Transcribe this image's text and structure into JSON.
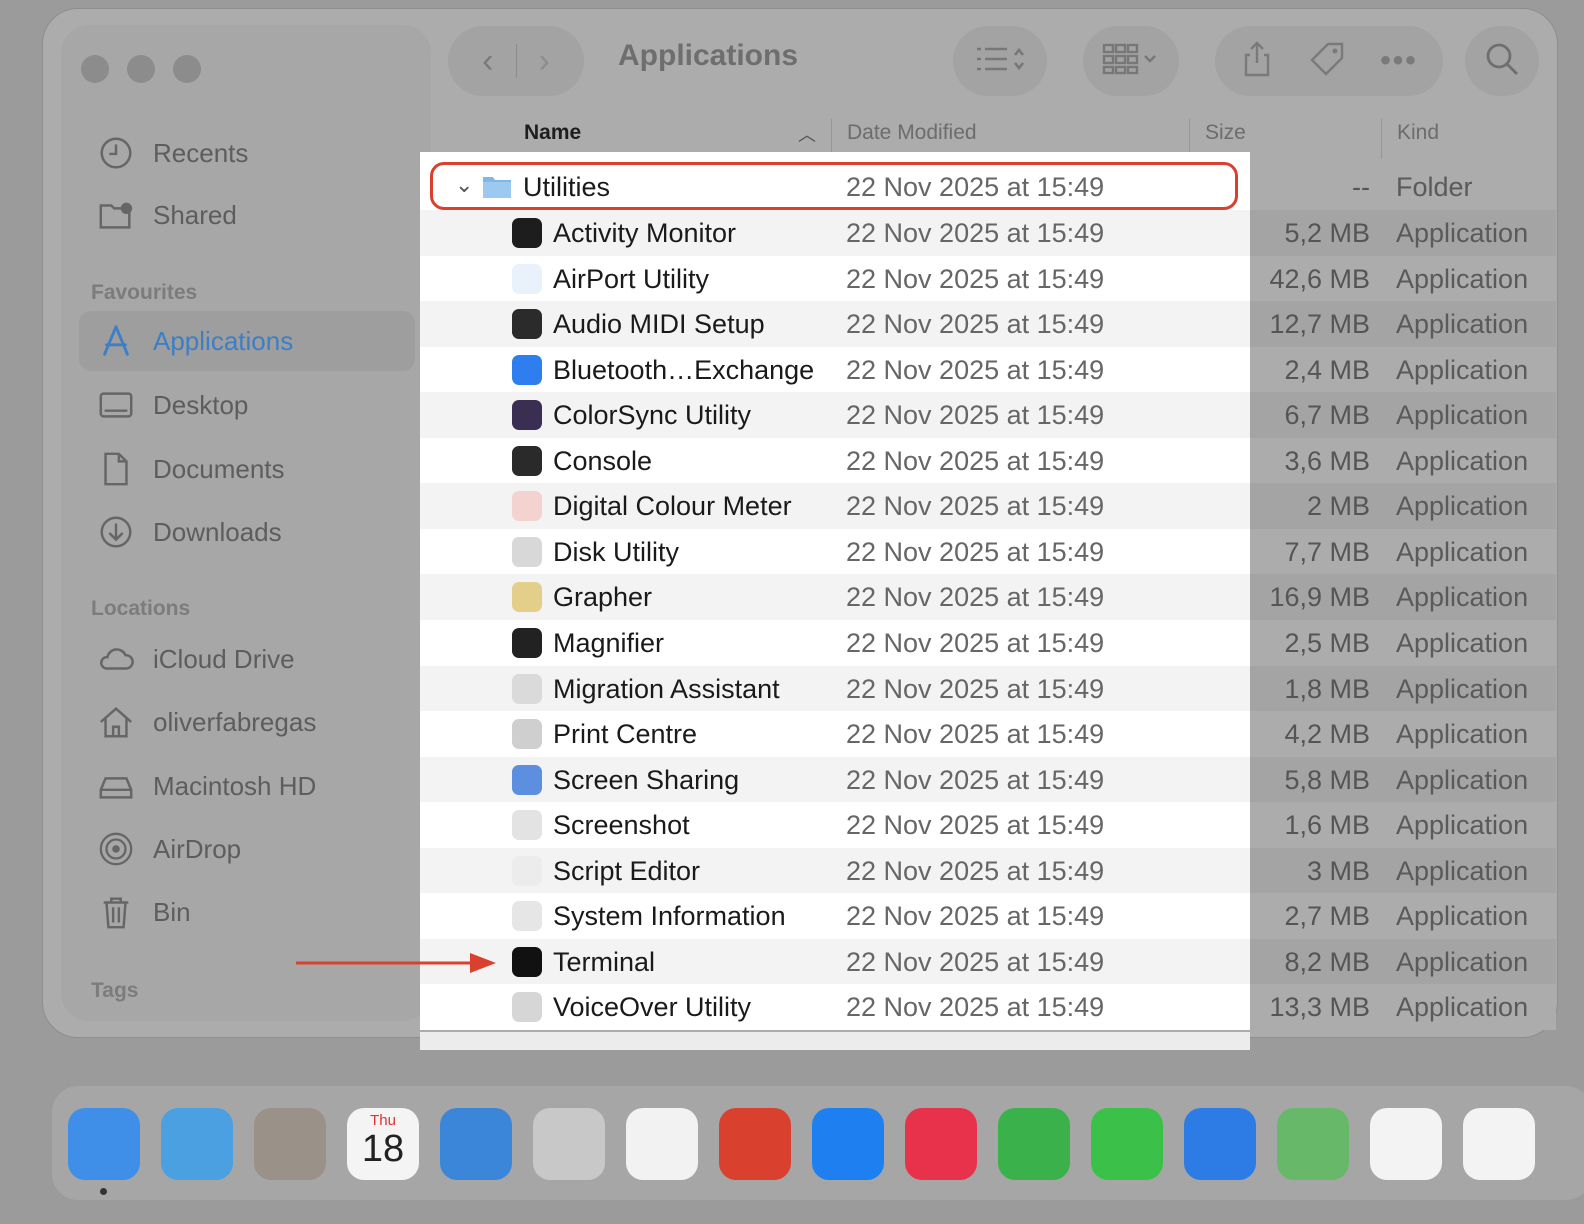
{
  "window": {
    "title": "Applications"
  },
  "sidebar": {
    "items_top": [
      {
        "label": "Recents",
        "icon": "clock-icon"
      },
      {
        "label": "Shared",
        "icon": "shared-folder-icon"
      }
    ],
    "favourites_heading": "Favourites",
    "favourites": [
      {
        "label": "Applications",
        "icon": "applications-icon",
        "active": true
      },
      {
        "label": "Desktop",
        "icon": "desktop-icon"
      },
      {
        "label": "Documents",
        "icon": "document-icon"
      },
      {
        "label": "Downloads",
        "icon": "download-icon"
      }
    ],
    "locations_heading": "Locations",
    "locations": [
      {
        "label": "iCloud Drive",
        "icon": "cloud-icon"
      },
      {
        "label": "oliverfabregas",
        "icon": "home-icon"
      },
      {
        "label": "Macintosh HD",
        "icon": "disk-icon"
      },
      {
        "label": "AirDrop",
        "icon": "airdrop-icon"
      },
      {
        "label": "Bin",
        "icon": "trash-icon"
      }
    ],
    "tags_heading": "Tags"
  },
  "columns": {
    "name": "Name",
    "date": "Date Modified",
    "size": "Size",
    "kind": "Kind"
  },
  "folder": {
    "name": "Utilities",
    "date": "22 Nov 2025 at 15:49",
    "size": "--",
    "kind": "Folder"
  },
  "rows": [
    {
      "name": "Activity Monitor",
      "date": "22 Nov 2025 at 15:49",
      "size": "5,2 MB",
      "kind": "Application",
      "color": "#1d1d1d"
    },
    {
      "name": "AirPort Utility",
      "date": "22 Nov 2025 at 15:49",
      "size": "42,6 MB",
      "kind": "Application",
      "color": "#e9f1fb"
    },
    {
      "name": "Audio MIDI Setup",
      "date": "22 Nov 2025 at 15:49",
      "size": "12,7 MB",
      "kind": "Application",
      "color": "#2b2b2b"
    },
    {
      "name": "Bluetooth…Exchange",
      "date": "22 Nov 2025 at 15:49",
      "size": "2,4 MB",
      "kind": "Application",
      "color": "#2f7ef0"
    },
    {
      "name": "ColorSync Utility",
      "date": "22 Nov 2025 at 15:49",
      "size": "6,7 MB",
      "kind": "Application",
      "color": "#3a2f52"
    },
    {
      "name": "Console",
      "date": "22 Nov 2025 at 15:49",
      "size": "3,6 MB",
      "kind": "Application",
      "color": "#2a2a2a"
    },
    {
      "name": "Digital Colour Meter",
      "date": "22 Nov 2025 at 15:49",
      "size": "2 MB",
      "kind": "Application",
      "color": "#f4d2cf"
    },
    {
      "name": "Disk Utility",
      "date": "22 Nov 2025 at 15:49",
      "size": "7,7 MB",
      "kind": "Application",
      "color": "#d8d8d8"
    },
    {
      "name": "Grapher",
      "date": "22 Nov 2025 at 15:49",
      "size": "16,9 MB",
      "kind": "Application",
      "color": "#e4cf8a"
    },
    {
      "name": "Magnifier",
      "date": "22 Nov 2025 at 15:49",
      "size": "2,5 MB",
      "kind": "Application",
      "color": "#222222"
    },
    {
      "name": "Migration Assistant",
      "date": "22 Nov 2025 at 15:49",
      "size": "1,8 MB",
      "kind": "Application",
      "color": "#dadada"
    },
    {
      "name": "Print Centre",
      "date": "22 Nov 2025 at 15:49",
      "size": "4,2 MB",
      "kind": "Application",
      "color": "#cfcfcf"
    },
    {
      "name": "Screen Sharing",
      "date": "22 Nov 2025 at 15:49",
      "size": "5,8 MB",
      "kind": "Application",
      "color": "#5d8fe0"
    },
    {
      "name": "Screenshot",
      "date": "22 Nov 2025 at 15:49",
      "size": "1,6 MB",
      "kind": "Application",
      "color": "#e3e3e3"
    },
    {
      "name": "Script Editor",
      "date": "22 Nov 2025 at 15:49",
      "size": "3 MB",
      "kind": "Application",
      "color": "#ececec"
    },
    {
      "name": "System Information",
      "date": "22 Nov 2025 at 15:49",
      "size": "2,7 MB",
      "kind": "Application",
      "color": "#e6e6e6"
    },
    {
      "name": "Terminal",
      "date": "22 Nov 2025 at 15:49",
      "size": "8,2 MB",
      "kind": "Application",
      "color": "#111111"
    },
    {
      "name": "VoiceOver Utility",
      "date": "22 Nov 2025 at 15:49",
      "size": "13,3 MB",
      "kind": "Application",
      "color": "#d6d6d6"
    }
  ],
  "dock": {
    "calendar": {
      "month": "Thu",
      "day": "18"
    },
    "apps": [
      {
        "name": "finder-icon",
        "color": "#3f8fe8"
      },
      {
        "name": "mk-app-icon",
        "color": "#4aa0e0"
      },
      {
        "name": "contacts-icon",
        "color": "#9a9288"
      },
      {
        "name": "calendar-icon",
        "color": "#f4f4f4"
      },
      {
        "name": "safari-icon",
        "color": "#3b86d9"
      },
      {
        "name": "launchpad-icon",
        "color": "#c8c8c8"
      },
      {
        "name": "reminders-icon",
        "color": "#f2f2f2"
      },
      {
        "name": "rocket-app-icon",
        "color": "#d9402e"
      },
      {
        "name": "app-store-icon",
        "color": "#1e7ff0"
      },
      {
        "name": "music-icon",
        "color": "#e8324b"
      },
      {
        "name": "phone-icon",
        "color": "#3bb14b"
      },
      {
        "name": "messages-icon",
        "color": "#3bc14a"
      },
      {
        "name": "mail-icon",
        "color": "#2d7be4"
      },
      {
        "name": "maps-icon",
        "color": "#68b86a"
      },
      {
        "name": "photos-icon",
        "color": "#f3f3f3"
      },
      {
        "name": "opera-icon",
        "color": "#f3f3f3"
      }
    ]
  }
}
